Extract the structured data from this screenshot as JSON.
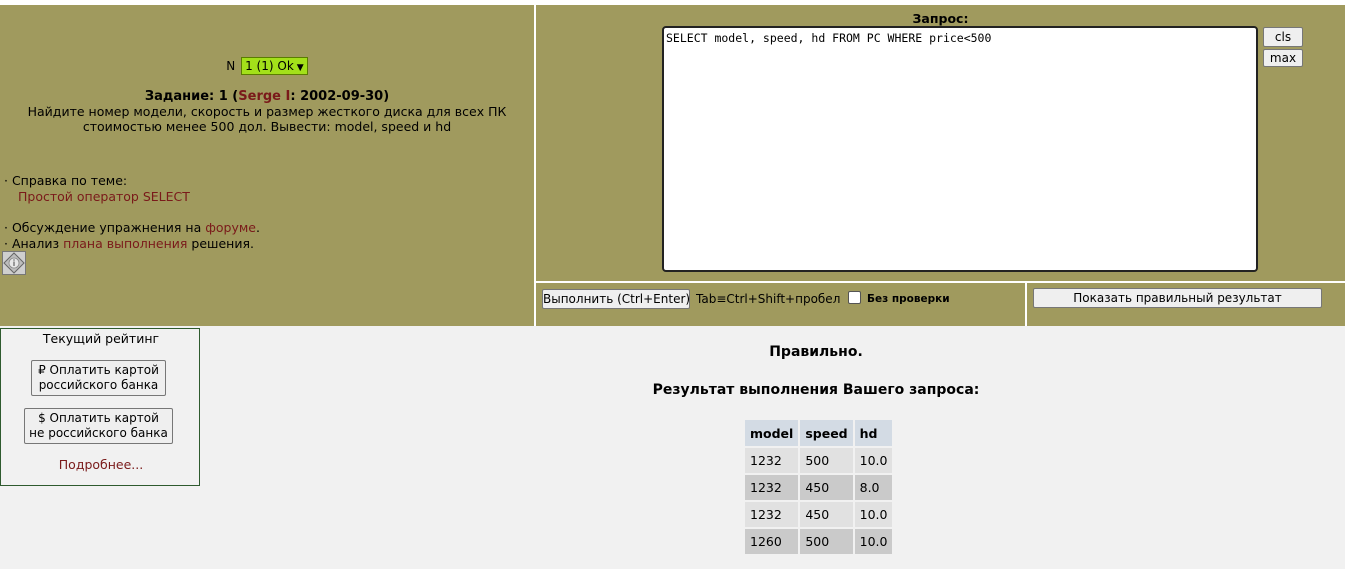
{
  "task": {
    "n_label": "N",
    "selected_option": "1 (1) Ok",
    "title_prefix": "Задание: 1 (",
    "author": "Serge I",
    "title_suffix": ": 2002-09-30)",
    "text": "Найдите номер модели, скорость и размер жесткого диска для всех ПК стоимостью менее 500 дол. Вывести: model, speed и hd"
  },
  "help": {
    "topic_label": "· Справка по теме:",
    "topic_link": "Простой оператор SELECT",
    "forum_prefix": "· Обсуждение упражнения на ",
    "forum_link": "форуме",
    "forum_suffix": ".",
    "plan_prefix": "· Анализ ",
    "plan_link": "плана выполнения",
    "plan_suffix": " решения."
  },
  "query": {
    "label": "Запрос:",
    "text": "SELECT model, speed, hd FROM PC WHERE price<500",
    "cls_label": "cls",
    "max_label": "max"
  },
  "toolbar": {
    "exec_label": "Выполнить (Ctrl+Enter)",
    "tab_hint": "Tab≡Ctrl+Shift+пробел",
    "no_check_label": "Без проверки",
    "no_check_checked": false,
    "show_result_label": "Показать правильный результат"
  },
  "rating": {
    "title": "Текущий рейтинг",
    "pay_rub_line1": "₽ Оплатить картой",
    "pay_rub_line2": "российского банка",
    "pay_usd_line1": "$ Оплатить картой",
    "pay_usd_line2": "не российского банка",
    "more_link": "Подробнее..."
  },
  "result": {
    "status": "Правильно.",
    "title": "Результат выполнения Вашего запроса:",
    "columns": [
      "model",
      "speed",
      "hd"
    ],
    "rows": [
      [
        "1232",
        "500",
        "10.0"
      ],
      [
        "1232",
        "450",
        "8.0"
      ],
      [
        "1232",
        "450",
        "10.0"
      ],
      [
        "1260",
        "500",
        "10.0"
      ]
    ]
  },
  "colors": {
    "panel_bg": "#a09a5e",
    "page_bg": "#f1f1f1",
    "link": "#7a1a1a",
    "select_bg": "#a3e01a",
    "table_header": "#d3dbe4"
  }
}
